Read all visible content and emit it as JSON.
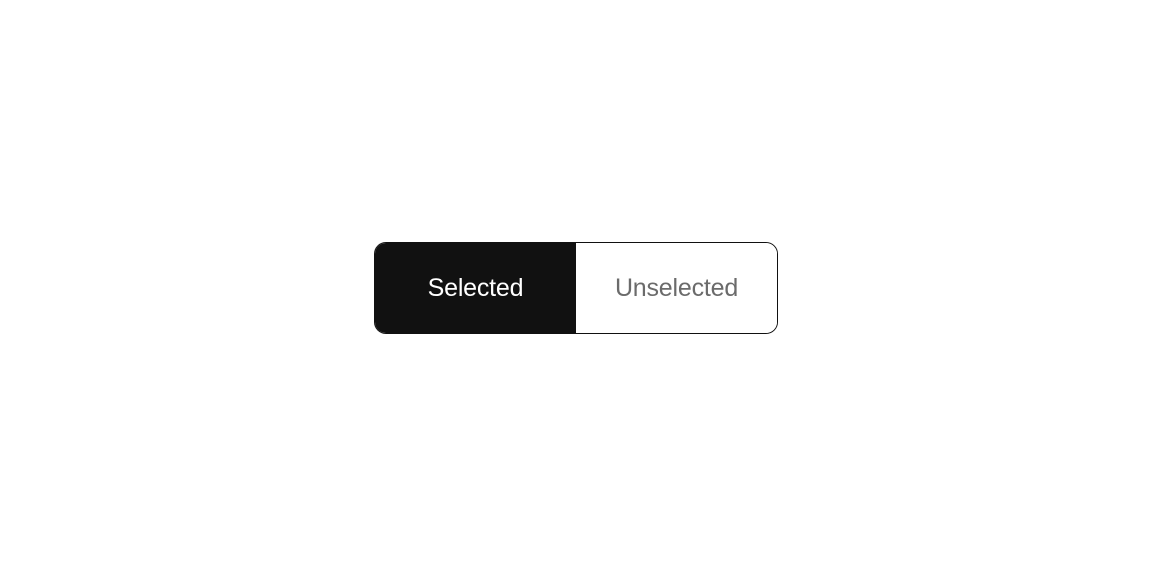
{
  "segmented": {
    "options": [
      {
        "label": "Selected",
        "selected": true
      },
      {
        "label": "Unselected",
        "selected": false
      }
    ]
  }
}
